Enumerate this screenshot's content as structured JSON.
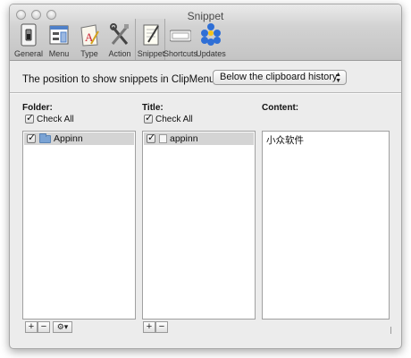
{
  "window": {
    "title": "Snippet"
  },
  "toolbar": {
    "items": [
      {
        "label": "General",
        "icon": "general-switch-icon"
      },
      {
        "label": "Menu",
        "icon": "menu-icon"
      },
      {
        "label": "Type",
        "icon": "type-icon"
      },
      {
        "label": "Action",
        "icon": "action-tools-icon"
      },
      {
        "label": "Snippet",
        "icon": "snippet-pen-icon",
        "selected": true
      },
      {
        "label": "Shortcuts",
        "icon": "keyboard-icon"
      },
      {
        "label": "Updates",
        "icon": "updates-dots-icon"
      }
    ]
  },
  "settings": {
    "position_label": "The position to show snippets in ClipMenu:",
    "position_value": "Below the clipboard history"
  },
  "folder": {
    "header": "Folder:",
    "check_all": "Check All",
    "items": [
      {
        "name": "Appinn",
        "checked": true
      }
    ]
  },
  "title_col": {
    "header": "Title:",
    "check_all": "Check All",
    "items": [
      {
        "name": "appinn",
        "checked": true
      }
    ]
  },
  "content_col": {
    "header": "Content:",
    "text": "小众软件"
  },
  "buttons": {
    "add": "+",
    "remove": "−",
    "gear": "⚙▾"
  },
  "colors": {
    "accent": "#7aa3d4",
    "selection": "#d4d4d4",
    "chrome": "#ececec"
  }
}
